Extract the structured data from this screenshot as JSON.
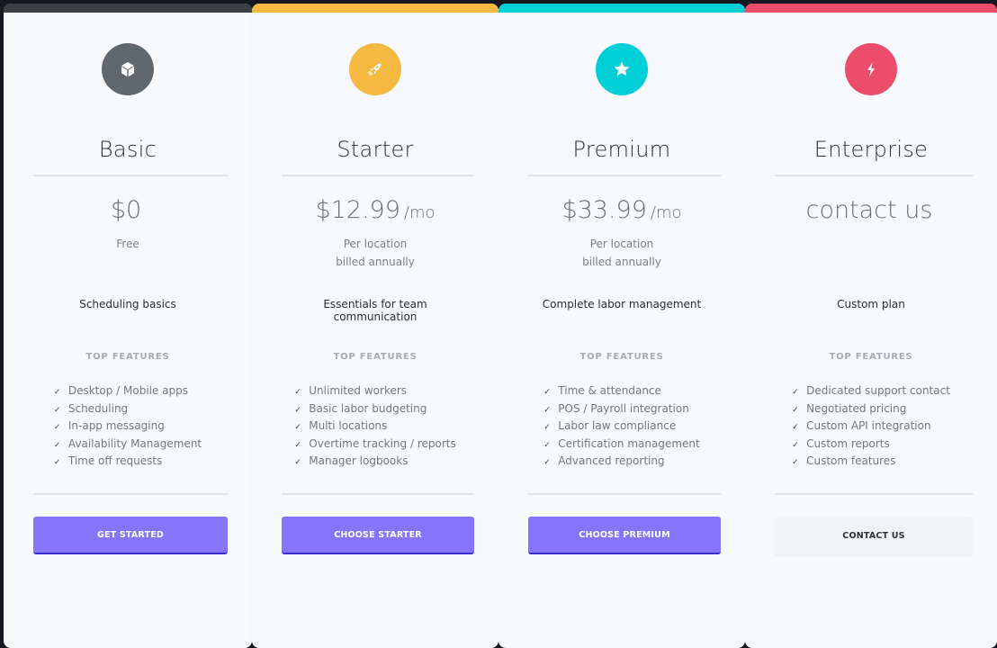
{
  "plans": [
    {
      "name": "Basic",
      "accent": "#3b4045",
      "icon_bg": "#60686f",
      "icon": "cube-icon",
      "price": "$0",
      "per": "",
      "sub1": "Free",
      "sub2": "",
      "description": "Scheduling basics",
      "features_label": "TOP FEATURES",
      "features": [
        "Desktop / Mobile apps",
        "Scheduling",
        "In-app messaging",
        "Availability Management",
        "Time off requests"
      ],
      "button": "GET STARTED",
      "button_style": "primary"
    },
    {
      "name": "Starter",
      "accent": "#f5b942",
      "icon_bg": "#f5b942",
      "icon": "rocket-icon",
      "price": "$12.99",
      "per": "/mo",
      "sub1": "Per location",
      "sub2": "billed annually",
      "description": "Essentials for team communication",
      "features_label": "TOP FEATURES",
      "features": [
        "Unlimited workers",
        "Basic labor budgeting",
        "Multi locations",
        "Overtime tracking / reports",
        "Manager logbooks"
      ],
      "button": "CHOOSE STARTER",
      "button_style": "primary"
    },
    {
      "name": "Premium",
      "accent": "#00cfd6",
      "icon_bg": "#00cfd6",
      "icon": "star-icon",
      "price": "$33.99",
      "per": "/mo",
      "sub1": "Per location",
      "sub2": "billed annually",
      "description": "Complete labor management",
      "features_label": "TOP FEATURES",
      "features": [
        "Time & attendance",
        "POS / Payroll integration",
        "Labor law compliance",
        "Certification management",
        "Advanced reporting"
      ],
      "button": "CHOOSE PREMIUM",
      "button_style": "primary"
    },
    {
      "name": "Enterprise",
      "accent": "#ec4d6b",
      "icon_bg": "#ec4d6b",
      "icon": "lightning-icon",
      "price": "contact us",
      "per": "",
      "sub1": "",
      "sub2": "",
      "description": "Custom plan",
      "features_label": "TOP FEATURES",
      "features": [
        "Dedicated support contact",
        "Negotiated pricing",
        "Custom API integration",
        "Custom reports",
        "Custom features"
      ],
      "button": "CONTACT US",
      "button_style": "secondary"
    }
  ],
  "check_glyph": "✓"
}
